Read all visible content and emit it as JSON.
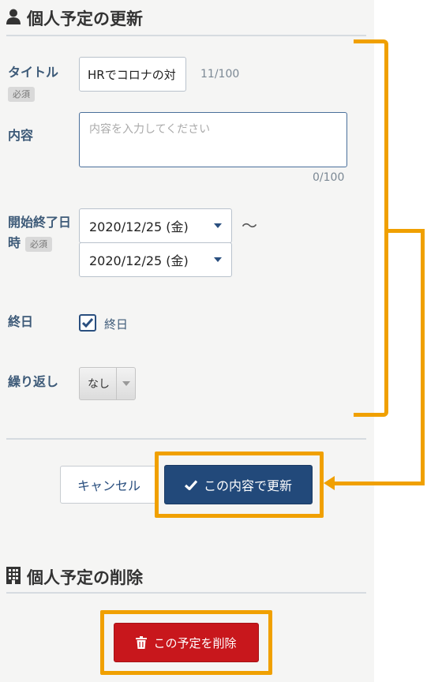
{
  "update_section": {
    "title": "個人予定の更新",
    "title_icon": "user-icon",
    "title_label": "タイトル",
    "required_badge": "必須",
    "title_value": "HRでコロナの対",
    "title_counter": "11/100",
    "content_label": "内容",
    "content_placeholder": "内容を入力してください",
    "content_counter": "0/100",
    "datetime_label_line1": "開始終了日",
    "datetime_label_line2": "時",
    "start_date": "2020/12/25 (金)",
    "end_date": "2020/12/25 (金)",
    "range_separator": "〜",
    "allday_label": "終日",
    "allday_checkbox_label": "終日",
    "allday_checked": true,
    "repeat_label": "繰り返し",
    "repeat_value": "なし",
    "cancel_button": "キャンセル",
    "submit_button": "この内容で更新"
  },
  "delete_section": {
    "title": "個人予定の削除",
    "title_icon": "building-icon",
    "delete_button": "この予定を削除"
  },
  "colors": {
    "primary": "#22497a",
    "danger": "#c8171c",
    "highlight": "#f0a000",
    "label": "#3d5a78"
  }
}
